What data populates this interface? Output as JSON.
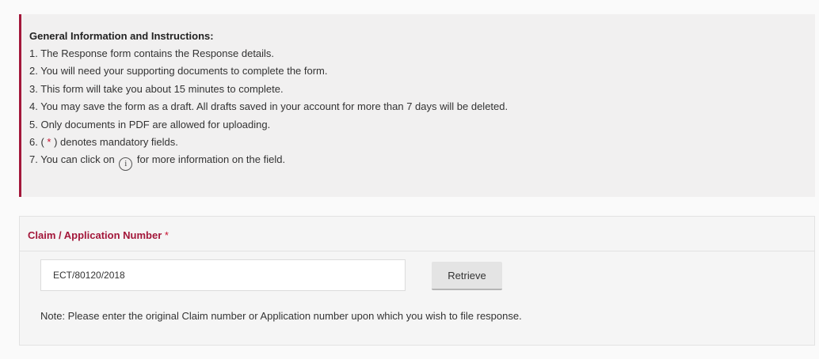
{
  "instructions": {
    "title": "General Information and Instructions:",
    "items": [
      "1. The Response form contains the Response details.",
      "2. You will need your supporting documents to complete the form.",
      "3. This form will take you about 15 minutes to complete.",
      "4. You may save the form as a draft. All drafts saved in your account for more than 7 days will be deleted.",
      "5. Only documents in PDF are allowed for uploading."
    ],
    "item6_prefix": "6. ( ",
    "item6_star": "*",
    "item6_suffix": " ) denotes mandatory fields.",
    "item7_prefix": "7. You can click on ",
    "item7_icon": "i",
    "item7_suffix": " for more information on the field."
  },
  "claim": {
    "label": "Claim / Application Number",
    "required_mark": "*",
    "input_value": "ECT/80120/2018",
    "retrieve_label": "Retrieve",
    "note": "Note: Please enter the original Claim number or Application number upon which you wish to file response."
  },
  "colors": {
    "accent": "#a3173a",
    "required": "#c8102e"
  },
  "icons": {
    "info": "info-icon"
  }
}
